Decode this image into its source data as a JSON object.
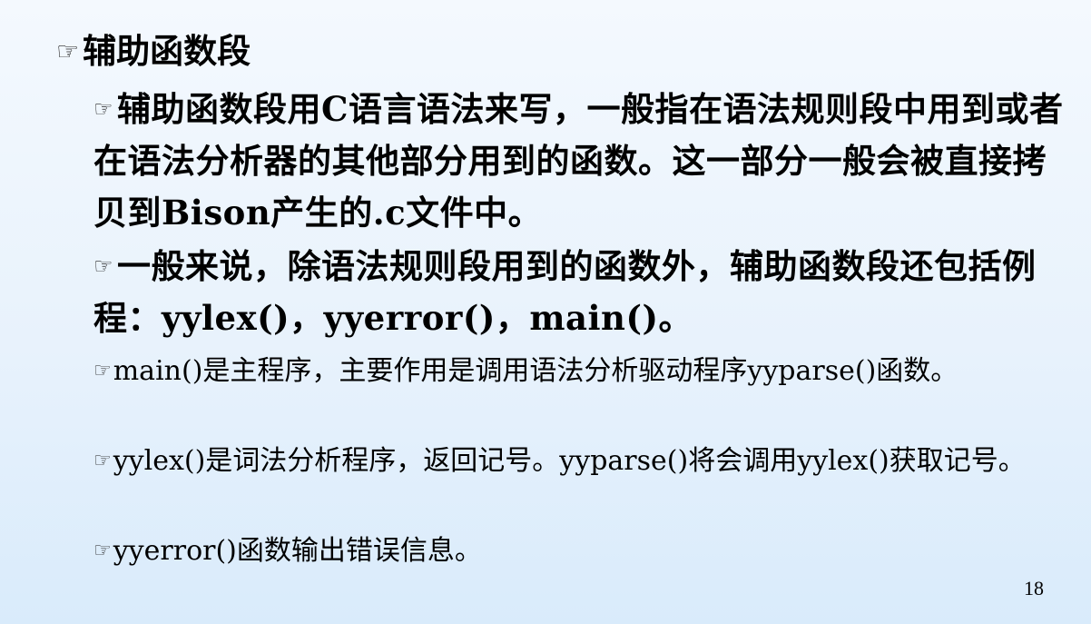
{
  "slide": {
    "heading": "辅助函数段",
    "bullets": [
      "辅助函数段用C语言语法来写，一般指在语法规则段中用到或者在语法分析器的其他部分用到的函数。这一部分一般会被直接拷贝到Bison产生的.c文件中。",
      "一般来说，除语法规则段用到的函数外，辅助函数段还包括例程：yylex()，yyerror()，main()。"
    ],
    "sub_bullets": [
      "main()是主程序，主要作用是调用语法分析驱动程序yyparse()函数。",
      "yylex()是词法分析程序，返回记号。yyparse()将会调用yylex()获取记号。",
      "yyerror()函数输出错误信息。"
    ],
    "page_number": "18"
  },
  "icons": {
    "bullet": "pointing-hand-icon",
    "bullet_glyph": "☞"
  }
}
